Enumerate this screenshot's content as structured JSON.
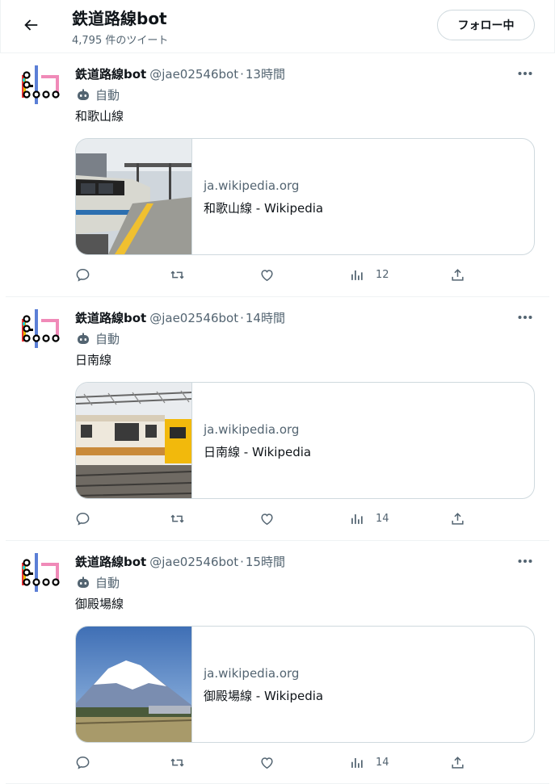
{
  "header": {
    "title": "鉄道路線bot",
    "tweet_count": "4,795 件のツイート",
    "follow_label": "フォロー中"
  },
  "tweets": [
    {
      "name": "鉄道路線bot",
      "handle": "@jae02546bot",
      "sep": "·",
      "time": "13時間",
      "auto_label": "自動",
      "text": "和歌山線",
      "card": {
        "domain": "ja.wikipedia.org",
        "title": "和歌山線 - Wikipedia"
      },
      "views": "12"
    },
    {
      "name": "鉄道路線bot",
      "handle": "@jae02546bot",
      "sep": "·",
      "time": "14時間",
      "auto_label": "自動",
      "text": "日南線",
      "card": {
        "domain": "ja.wikipedia.org",
        "title": "日南線 - Wikipedia"
      },
      "views": "14"
    },
    {
      "name": "鉄道路線bot",
      "handle": "@jae02546bot",
      "sep": "·",
      "time": "15時間",
      "auto_label": "自動",
      "text": "御殿場線",
      "card": {
        "domain": "ja.wikipedia.org",
        "title": "御殿場線 - Wikipedia"
      },
      "views": "14"
    }
  ],
  "icons": {
    "back": "arrow-left-icon",
    "more": "more-dots-icon",
    "bot": "bot-icon",
    "reply": "reply-icon",
    "retweet": "retweet-icon",
    "like": "heart-icon",
    "views": "bar-chart-icon",
    "share": "share-icon"
  },
  "colors": {
    "text": "#0f1419",
    "muted": "#536471",
    "border": "#cfd9de"
  }
}
